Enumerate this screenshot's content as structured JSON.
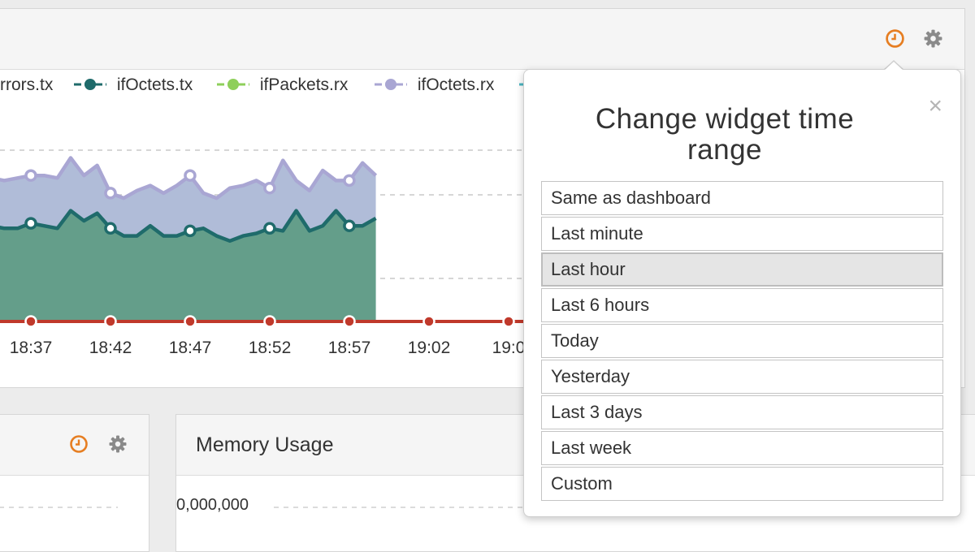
{
  "top_widget": {
    "legend": [
      {
        "label": "rrors.tx",
        "color": "#ffffff"
      },
      {
        "label": "ifOctets.tx",
        "color": "#1f6b6b"
      },
      {
        "label": "ifPackets.rx",
        "color": "#8ecf5a"
      },
      {
        "label": "ifOctets.rx",
        "color": "#a9a6d3"
      }
    ],
    "icons": [
      "clock-icon",
      "gear-icon"
    ],
    "accent_color": "#e67e22"
  },
  "chart_data": {
    "type": "area",
    "x_tick_labels": [
      "18:37",
      "18:42",
      "18:47",
      "18:52",
      "18:57",
      "19:02",
      "19:0"
    ],
    "series": [
      {
        "name": "ifOctets.tx",
        "color": "#1f6b6b",
        "fill": "#649e8a",
        "values": [
          0.36,
          0.37,
          0.37,
          0.38,
          0.37,
          0.37,
          0.39,
          0.38,
          0.37,
          0.44,
          0.4,
          0.43,
          0.37,
          0.34,
          0.34,
          0.38,
          0.34,
          0.34,
          0.36,
          0.37,
          0.34,
          0.32,
          0.34,
          0.35,
          0.37,
          0.36,
          0.44,
          0.36,
          0.38,
          0.44,
          0.38,
          0.38,
          0.41
        ]
      },
      {
        "name": "ifOctets.rx",
        "color": "#a9a6d3",
        "fill": "#b0bcd8",
        "values": [
          0.56,
          0.57,
          0.58,
          0.57,
          0.56,
          0.57,
          0.58,
          0.58,
          0.57,
          0.65,
          0.58,
          0.62,
          0.51,
          0.49,
          0.52,
          0.54,
          0.51,
          0.54,
          0.58,
          0.51,
          0.49,
          0.53,
          0.54,
          0.56,
          0.53,
          0.64,
          0.56,
          0.52,
          0.6,
          0.56,
          0.56,
          0.63,
          0.58
        ]
      },
      {
        "name": "ifErrors.tx",
        "color": "#c0392b",
        "values": [
          0,
          0,
          0,
          0,
          0,
          0,
          0
        ]
      }
    ]
  },
  "left_widget": {
    "icons": [
      "clock-icon",
      "gear-icon"
    ]
  },
  "memory_widget": {
    "title": "Memory Usage",
    "y_tick_label": "0,000,000"
  },
  "popover": {
    "title": "Change widget time range",
    "close_label": "×",
    "options": [
      {
        "label": "Same as dashboard",
        "selected": false
      },
      {
        "label": "Last minute",
        "selected": false
      },
      {
        "label": "Last hour",
        "selected": true
      },
      {
        "label": "Last 6 hours",
        "selected": false
      },
      {
        "label": "Today",
        "selected": false
      },
      {
        "label": "Yesterday",
        "selected": false
      },
      {
        "label": "Last 3 days",
        "selected": false
      },
      {
        "label": "Last week",
        "selected": false
      },
      {
        "label": "Custom",
        "selected": false
      }
    ]
  }
}
